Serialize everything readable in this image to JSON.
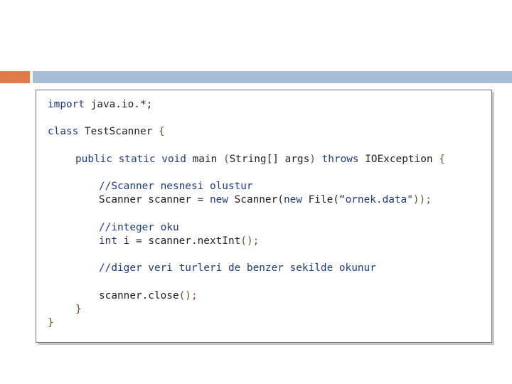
{
  "code": {
    "lines": {
      "l1": {
        "t1": "import",
        "t2": " java.io.*;"
      },
      "l2": {
        "t1": "class",
        "t2": " TestScanner ",
        "t3": "{"
      },
      "l3": {
        "t1": "public static void",
        "t2": " main ",
        "t3": "(",
        "t4": "String[] args",
        "t5": ")",
        "t6": " throws",
        "t7": " IOException ",
        "t8": "{"
      },
      "l4": {
        "t1": "//Scanner nesnesi olustur"
      },
      "l5": {
        "t1": "Scanner scanner = ",
        "t2": "new",
        "t3": " Scanner(",
        "t4": "new",
        "t5": " File(",
        "t6": "“ornek.data\"",
        "t7": "));"
      },
      "l6": {
        "t1": "//integer oku"
      },
      "l7": {
        "t1": "int",
        "t2": " i = scanner.nextInt",
        "t3": "();"
      },
      "l8": {
        "t1": "//diger veri turleri de benzer sekilde okunur"
      },
      "l9": {
        "t1": "scanner.close",
        "t2": "();"
      },
      "l10": {
        "t1": "}"
      },
      "l11": {
        "t1": "}"
      }
    }
  },
  "colors": {
    "accent_orange": "#e07b4a",
    "accent_blue": "#a6bdd6",
    "keyword": "#1d3a8a",
    "punctuation": "#7a4e24"
  }
}
